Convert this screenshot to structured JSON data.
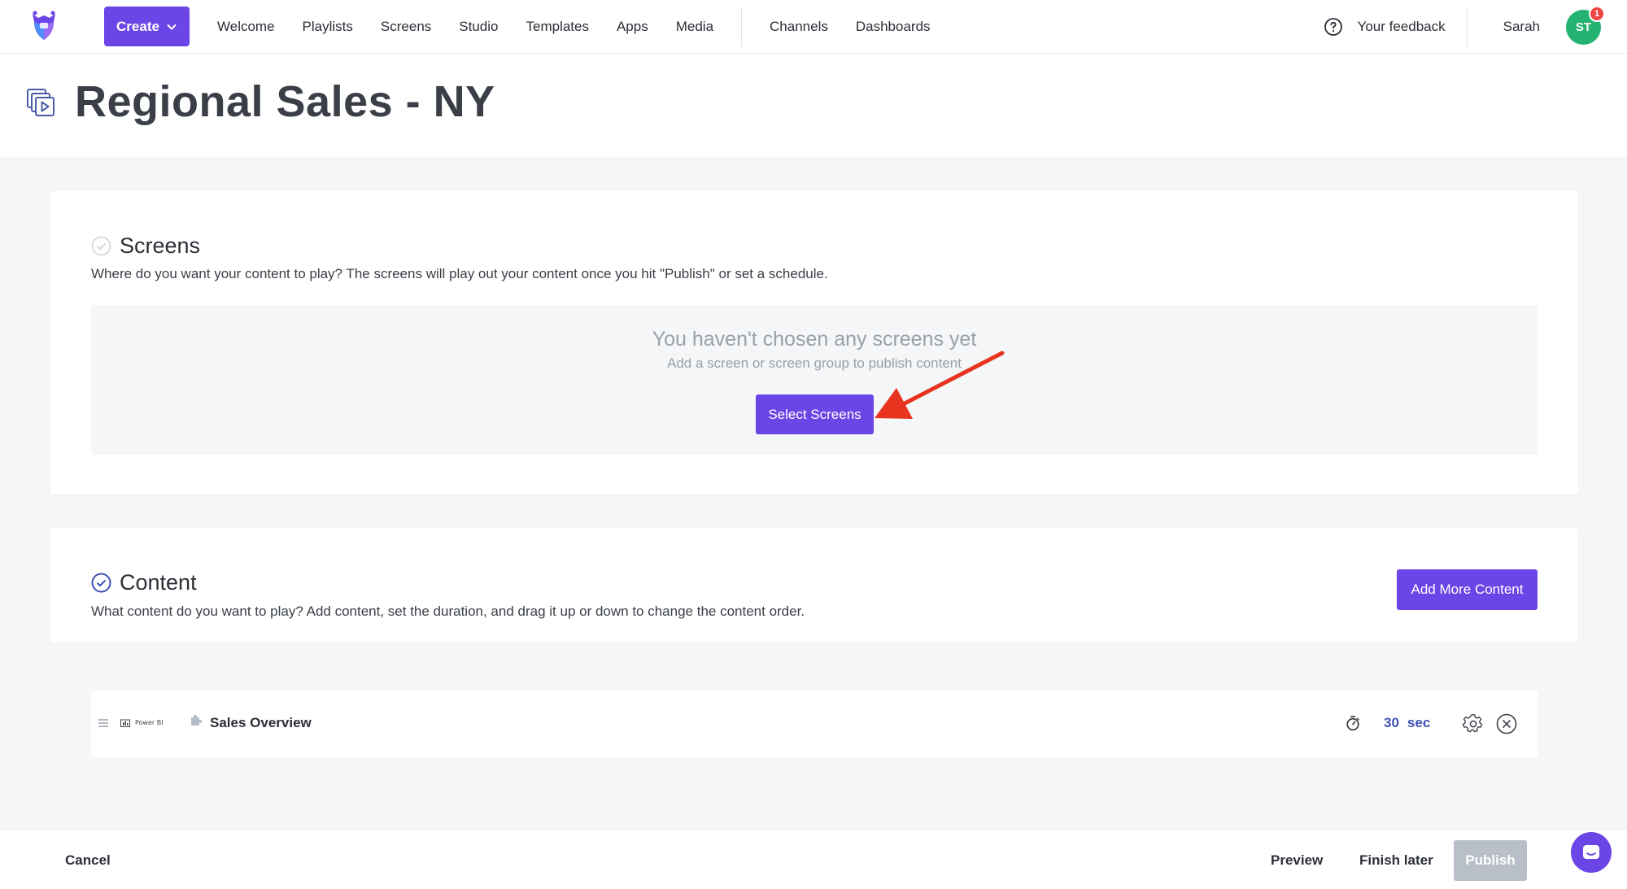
{
  "header": {
    "create_label": "Create",
    "nav": [
      "Welcome",
      "Playlists",
      "Screens",
      "Studio",
      "Templates",
      "Apps",
      "Media"
    ],
    "nav_secondary": [
      "Channels",
      "Dashboards"
    ],
    "feedback_label": "Your feedback",
    "user_name": "Sarah",
    "avatar_initials": "ST",
    "notification_count": "1"
  },
  "page": {
    "title": "Regional Sales - NY"
  },
  "screens_section": {
    "title": "Screens",
    "description": "Where do you want your content to play? The screens will play out your content once you hit \"Publish\" or set a schedule.",
    "empty_title": "You haven't chosen any screens yet",
    "empty_subtitle": "Add a screen or screen group to publish content",
    "select_button": "Select Screens"
  },
  "content_section": {
    "title": "Content",
    "description": "What content do you want to play? Add content, set the duration, and drag it up or down to change the content order.",
    "add_button": "Add More Content",
    "items": [
      {
        "source_label": "Power BI",
        "title": "Sales Overview",
        "duration_value": "30",
        "duration_unit": "sec"
      }
    ]
  },
  "footer": {
    "cancel": "Cancel",
    "preview": "Preview",
    "finish_later": "Finish later",
    "publish": "Publish"
  },
  "colors": {
    "accent": "#6b45e6",
    "avatar": "#23b26f",
    "badge": "#ef4444",
    "duration": "#3f51b5",
    "annotation_arrow": "#e8331e"
  },
  "icons": [
    "app-logo-icon",
    "chevron-down-icon",
    "help-icon",
    "playlist-icon",
    "check-circle-icon",
    "drag-handle-icon",
    "power-bi-logo-icon",
    "puzzle-icon",
    "timer-icon",
    "gear-icon",
    "close-circle-icon",
    "chat-icon",
    "annotation-arrow"
  ]
}
